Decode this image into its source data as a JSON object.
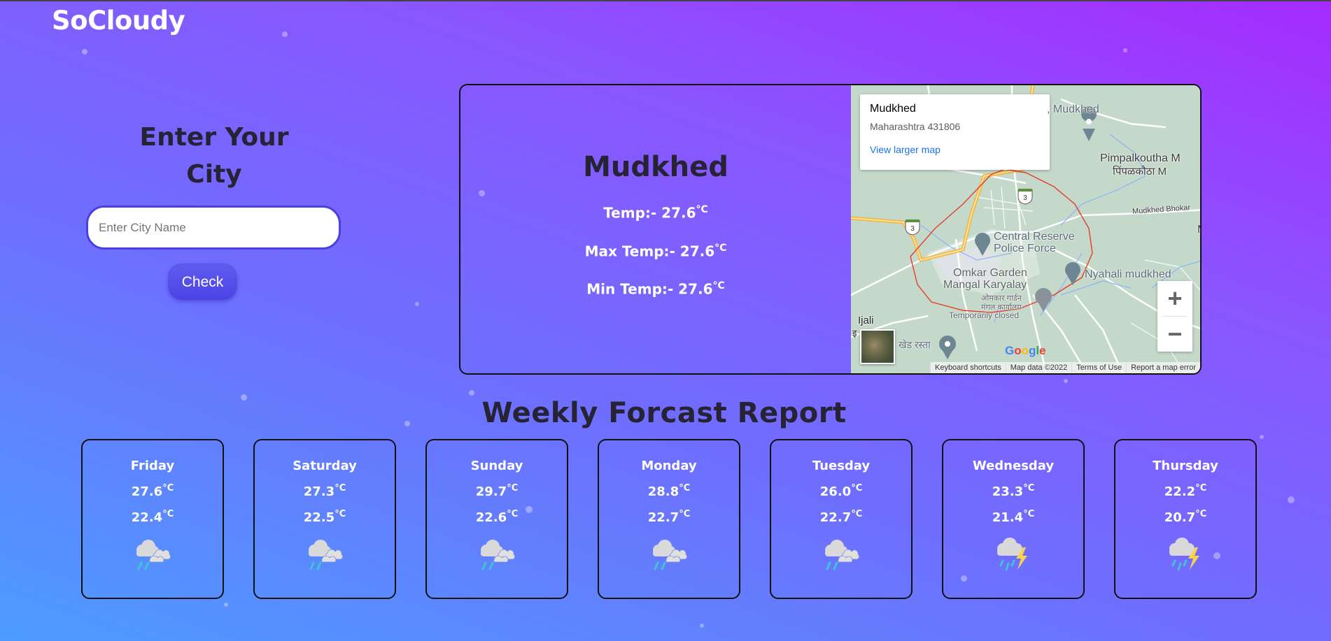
{
  "app": {
    "logo": "SoCloudy"
  },
  "search": {
    "heading": "Enter Your City",
    "input_value": "",
    "input_placeholder": "Enter City Name",
    "button_label": "Check"
  },
  "current": {
    "city": "Mudkhed",
    "temp_label": "Temp:- 27.6",
    "max_label": "Max Temp:- 27.6",
    "min_label": "Min Temp:- 27.6",
    "unit": "°C"
  },
  "map": {
    "info_title": "Mudkhed",
    "info_address": "Maharashtra 431806",
    "info_link": "View larger map",
    "labels": {
      "top_place": ", Mudkhed",
      "pimpal_en": "Pimpalkoutha M",
      "pimpal_hi": "पिंपळकौठा M",
      "road": "Mudkhed Bhokar",
      "crpf_1": "Central Reserve",
      "crpf_2": "Police Force",
      "nyahali": "Nyahali mudkhed",
      "omkar_1": "Omkar Garden",
      "omkar_2": "Mangal Karyalay",
      "omkar_hi_1": "ओमकार गार्डन",
      "omkar_hi_2": "मंगल कार्यालय",
      "omkar_status": "Temporarily closed",
      "ijali": "Ijali",
      "ijali_hi": "इ",
      "road_hi": "खेड रस्ता",
      "edge_m": "M",
      "highway_num": "3"
    },
    "zoom_in": "+",
    "zoom_out": "−",
    "google": [
      "G",
      "o",
      "o",
      "g",
      "l",
      "e"
    ],
    "attribution": [
      "Keyboard shortcuts",
      "Map data ©2022",
      "Terms of Use",
      "Report a map error"
    ]
  },
  "weekly": {
    "title": "Weekly Forcast Report",
    "unit": "°C",
    "days": [
      {
        "day": "Friday",
        "max": "27.6",
        "min": "22.4",
        "icon": "cloud-rain-icon"
      },
      {
        "day": "Saturday",
        "max": "27.3",
        "min": "22.5",
        "icon": "cloud-rain-icon"
      },
      {
        "day": "Sunday",
        "max": "29.7",
        "min": "22.6",
        "icon": "cloud-rain-icon"
      },
      {
        "day": "Monday",
        "max": "28.8",
        "min": "22.7",
        "icon": "cloud-rain-icon"
      },
      {
        "day": "Tuesday",
        "max": "26.0",
        "min": "22.7",
        "icon": "cloud-rain-icon"
      },
      {
        "day": "Wednesday",
        "max": "23.3",
        "min": "21.4",
        "icon": "thunderstorm-icon"
      },
      {
        "day": "Thursday",
        "max": "22.2",
        "min": "20.7",
        "icon": "thunderstorm-icon"
      }
    ]
  },
  "colors": {
    "google": [
      "#4285F4",
      "#EA4335",
      "#FBBC05",
      "#4285F4",
      "#34A853",
      "#EA4335"
    ]
  }
}
